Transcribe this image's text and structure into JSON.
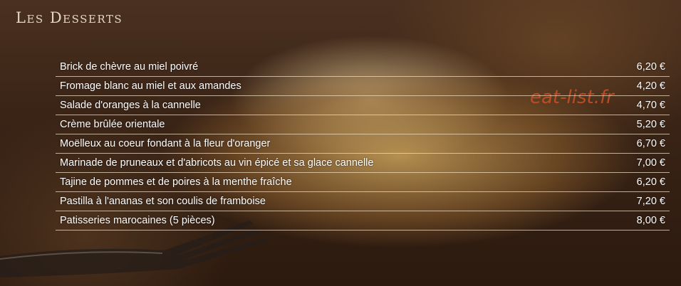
{
  "title": "Les Desserts",
  "watermark": "eat-list.fr",
  "menu": {
    "items": [
      {
        "name": "Brick de chèvre au miel poivré",
        "price": "6,20 €"
      },
      {
        "name": "Fromage blanc au miel et aux amandes",
        "price": "4,20 €"
      },
      {
        "name": "Salade d'oranges à la cannelle",
        "price": "4,70 €"
      },
      {
        "name": "Crème brûlée orientale",
        "price": "5,20 €"
      },
      {
        "name": "Moëlleux au coeur fondant à la fleur d'oranger",
        "price": "6,70 €"
      },
      {
        "name": "Marinade de pruneaux et d'abricots au vin épicé et sa glace cannelle",
        "price": "7,00 €"
      },
      {
        "name": "Tajine de pommes et de poires à la menthe fraîche",
        "price": "6,20 €"
      },
      {
        "name": "Pastilla à l'ananas et son coulis de framboise",
        "price": "7,20 €"
      },
      {
        "name": "Patisseries marocaines (5 pièces)",
        "price": "8,00 €"
      }
    ]
  }
}
